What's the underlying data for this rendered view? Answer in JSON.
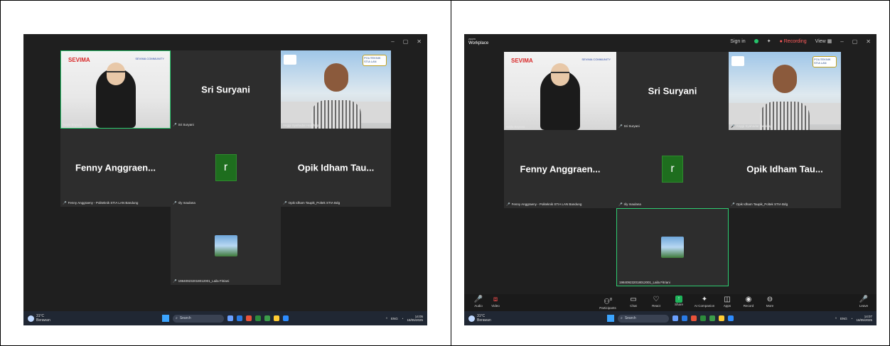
{
  "left": {
    "window_controls": [
      "–",
      "▢",
      "✕"
    ],
    "tiles": {
      "woman_brand": "SEVIMA",
      "woman_community": "SEVIMA COMMUNITY",
      "woman_tag": "Najla Bsyuna",
      "sri": "Sri Suryani",
      "sri_tag": "Sri Suryani",
      "anggi_tag": "Anggi Syahadat Harahap",
      "anggi_logo": "POLITEKNIK STIA LAN",
      "fenny": "Fenny  Anggraen...",
      "fenny_tag": "Fenny Anggraeny - Politeknik STIA LAN Bandung",
      "r_letter": "r",
      "rily_tag": "rily maulana",
      "opik": "Opik Idham Tau...",
      "opik_tag": "Opik Idham Taupik_Poltek STIA Bdg",
      "laila_tag": "198409232018012001_Laila Fitriani"
    },
    "taskbar": {
      "temp": "31°C",
      "weather": "Berawan",
      "search": "Search",
      "lang": "ENG",
      "time": "14:05",
      "date": "18/05/2025"
    }
  },
  "right": {
    "brand_top": "zoom",
    "brand": "Workplace",
    "topbar": {
      "sign_in": "Sign in",
      "recording": "● Recording",
      "view": "View ▦",
      "window_controls": [
        "–",
        "▢",
        "✕"
      ]
    },
    "tiles": {
      "woman_brand": "SEVIMA",
      "woman_community": "SEVIMA COMMUNITY",
      "woman_tag": "Najla Bsyuna",
      "sri": "Sri Suryani",
      "sri_tag": "Sri Suryani",
      "anggi_tag": "Anggi Syahadat Harahap",
      "anggi_logo": "POLITEKNIK STIA LAN",
      "fenny": "Fenny  Anggraen...",
      "fenny_tag": "Fenny Anggraeny - Politeknik STIA LAN Bandung",
      "r_letter": "r",
      "rily_tag": "rily maulana",
      "opik": "Opik Idham Tau...",
      "opik_tag": "Opik Idham Taupik_Poltek STIA Bdg",
      "laila_tag": "198409232018012001_Laila Fitriani"
    },
    "toolbar": {
      "audio": "Audio",
      "video": "Video",
      "participants": "Participants",
      "participants_count": "8",
      "chat": "Chat",
      "react": "React",
      "share": "Share",
      "ai_companion": "AI Companion",
      "apps": "Apps",
      "record": "Record",
      "more": "More",
      "leave": "Leave"
    },
    "taskbar": {
      "temp": "31°C",
      "weather": "Berawan",
      "search": "Search",
      "lang": "ENG",
      "time": "14:07",
      "date": "18/05/2025"
    }
  }
}
